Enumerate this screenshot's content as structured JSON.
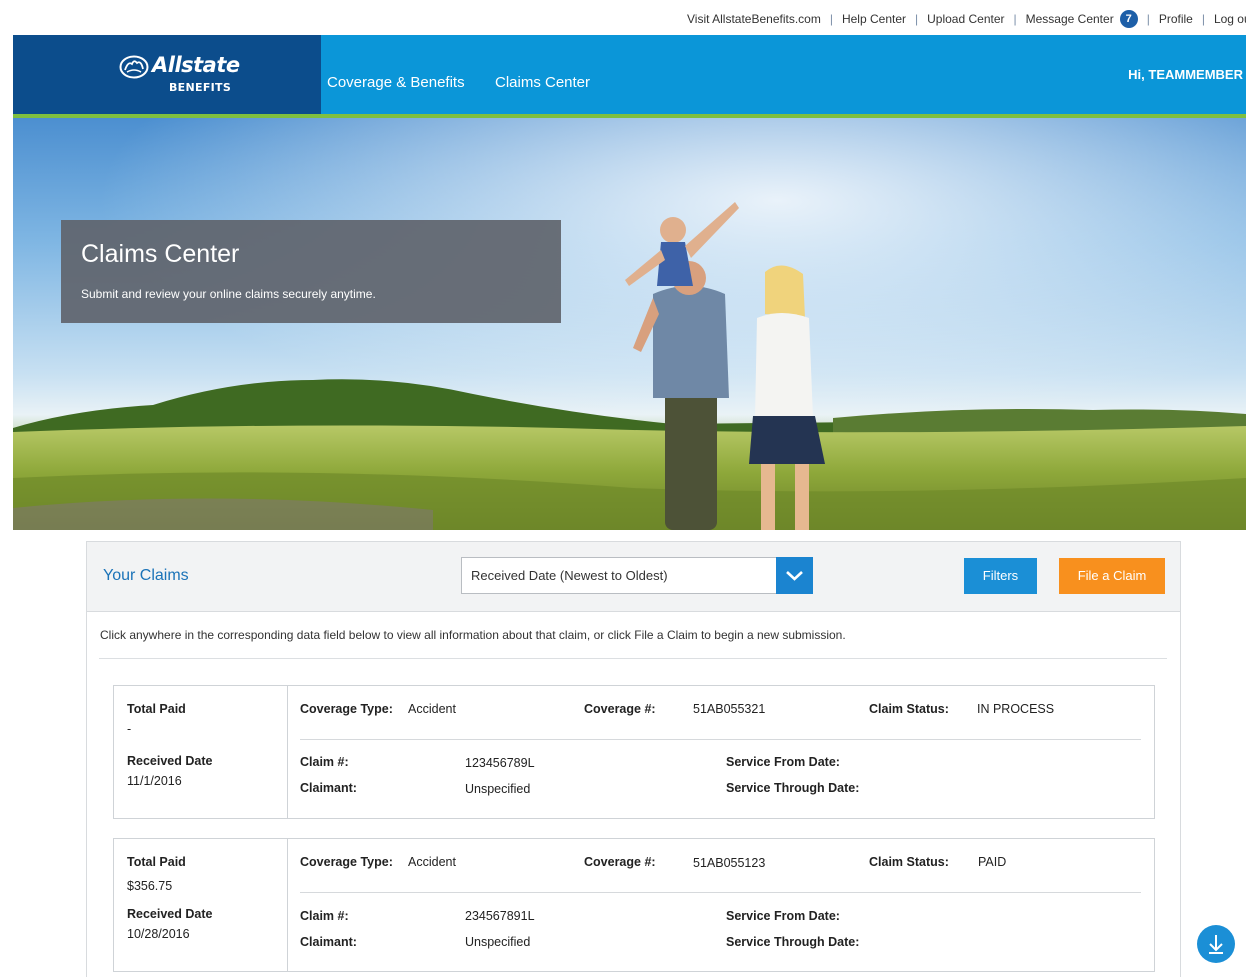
{
  "utility": {
    "links": [
      "Visit AllstateBenefits.com",
      "Help Center",
      "Upload Center",
      "Message Center",
      "Profile",
      "Log out"
    ],
    "message_count": "7"
  },
  "brand": {
    "name": "Allstate",
    "sub": "BENEFITS"
  },
  "nav": {
    "items": [
      "Coverage & Benefits",
      "Claims Center"
    ],
    "greeting": "Hi, TEAMMEMBER"
  },
  "hero": {
    "title": "Claims Center",
    "subtitle": "Submit and review your online claims securely anytime."
  },
  "claims_panel": {
    "title": "Your Claims",
    "sort_value": "Received Date (Newest to Oldest)",
    "filters_label": "Filters",
    "file_claim_label": "File a Claim",
    "instructions": "Click anywhere in the corresponding data field below to view all information about that claim, or click File a Claim to begin a new submission."
  },
  "labels": {
    "total_paid": "Total Paid",
    "received_date": "Received Date",
    "coverage_type": "Coverage Type:",
    "coverage_num": "Coverage #:",
    "claim_status": "Claim Status:",
    "claim_num": "Claim #:",
    "claimant": "Claimant:",
    "service_from": "Service From Date:",
    "service_through": "Service Through Date:"
  },
  "claims": [
    {
      "total_paid": "-",
      "received_date": "11/1/2016",
      "coverage_type": "Accident",
      "coverage_num": "51AB055321",
      "claim_status": "IN PROCESS",
      "claim_num": "123456789L",
      "claimant": "Unspecified"
    },
    {
      "total_paid": "$356.75",
      "received_date": "10/28/2016",
      "coverage_type": "Accident",
      "coverage_num": "51AB055123",
      "claim_status": "PAID",
      "claim_num": "234567891L",
      "claimant": "Unspecified"
    }
  ],
  "colors": {
    "nav_blue": "#0b96d8",
    "logo_navy": "#0c4d8c",
    "accent_green": "#7fbf3f",
    "button_blue": "#1b8fd6",
    "button_orange": "#f8901e"
  }
}
